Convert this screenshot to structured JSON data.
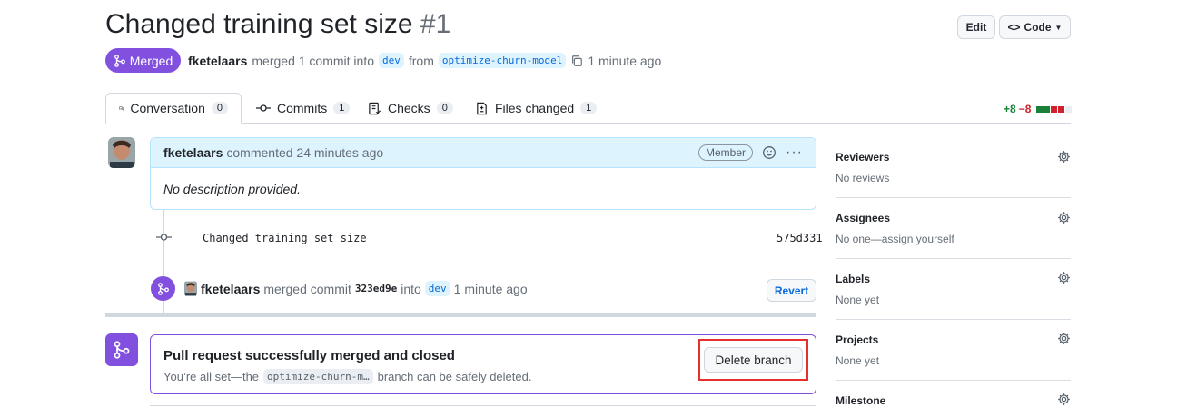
{
  "header": {
    "title": "Changed training set size",
    "number": "#1",
    "edit_label": "Edit",
    "code_label": "Code",
    "state_label": "Merged",
    "author": "fketelaars",
    "meta_text": "merged 1 commit into",
    "base_branch": "dev",
    "from_text": "from",
    "head_branch": "optimize-churn-model",
    "time": "1 minute ago"
  },
  "tabs": [
    {
      "label": "Conversation",
      "count": "0"
    },
    {
      "label": "Commits",
      "count": "1"
    },
    {
      "label": "Checks",
      "count": "0"
    },
    {
      "label": "Files changed",
      "count": "1"
    }
  ],
  "diffstat": {
    "additions": "+8",
    "deletions": "−8",
    "colors": [
      "#1a7f37",
      "#1a7f37",
      "#cf222e",
      "#cf222e",
      "#eaeef2"
    ]
  },
  "comment": {
    "author": "fketelaars",
    "action": "commented 24 minutes ago",
    "role": "Member",
    "body": "No description provided."
  },
  "commit": {
    "message": "Changed training set size",
    "sha": "575d331"
  },
  "merge_event": {
    "author": "fketelaars",
    "text": "merged commit",
    "sha": "323ed9e",
    "into": "into",
    "branch": "dev",
    "time": "1 minute ago",
    "revert_label": "Revert"
  },
  "status": {
    "title": "Pull request successfully merged and closed",
    "sub_prefix": "You’re all set—the",
    "branch": "optimize-churn-m…",
    "sub_suffix": "branch can be safely deleted.",
    "delete_label": "Delete branch"
  },
  "sidebar": {
    "sections": [
      {
        "title": "Reviewers",
        "value": "No reviews"
      },
      {
        "title": "Assignees",
        "value": "No one—assign yourself"
      },
      {
        "title": "Labels",
        "value": "None yet"
      },
      {
        "title": "Projects",
        "value": "None yet"
      },
      {
        "title": "Milestone",
        "value": ""
      }
    ]
  },
  "colors": {
    "merged": "#8250df",
    "link": "#0969da",
    "highlight": "#e5312e"
  }
}
